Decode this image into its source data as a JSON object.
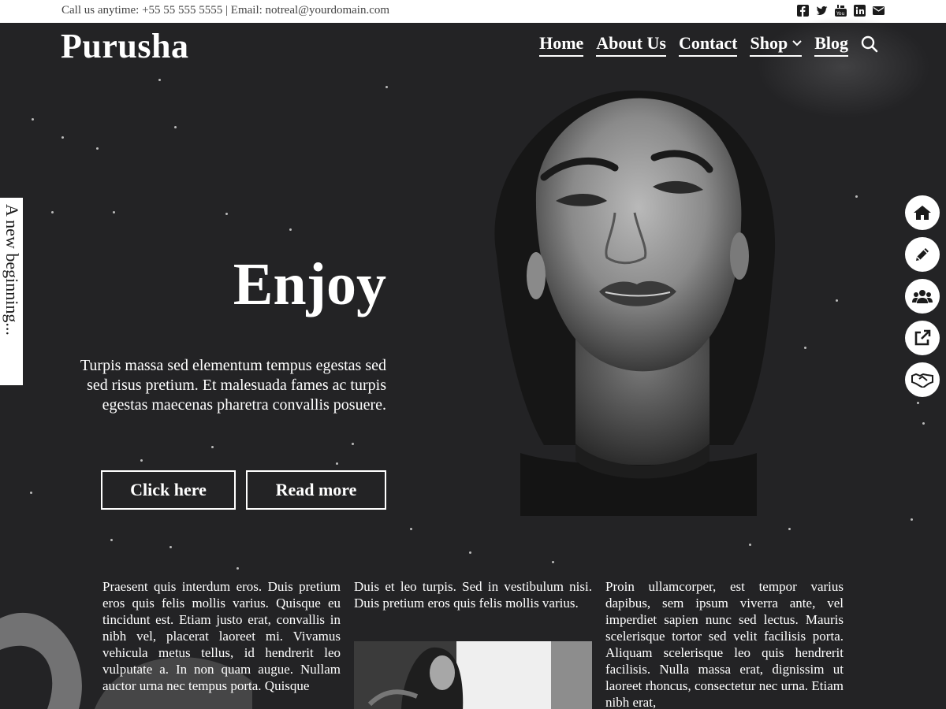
{
  "topbar": {
    "contact": "Call us anytime: +55 55 555 5555 | Email: notreal@yourdomain.com",
    "social_icons": [
      "facebook-icon",
      "twitter-icon",
      "youtube-icon",
      "linkedin-icon",
      "email-icon"
    ]
  },
  "header": {
    "logo": "Purusha",
    "nav": [
      {
        "label": "Home"
      },
      {
        "label": "About Us"
      },
      {
        "label": "Contact"
      },
      {
        "label": "Shop"
      },
      {
        "label": "Blog"
      }
    ]
  },
  "sidetab": {
    "label": "A new beginning..."
  },
  "hero": {
    "title": "Enjoy",
    "text": "Turpis massa sed elementum tempus egestas sed sed risus pretium. Et malesuada fames ac turpis egestas maecenas pharetra convallis posuere.",
    "buttons": [
      {
        "label": "Click here"
      },
      {
        "label": "Read more"
      }
    ]
  },
  "side_actions": [
    "home-icon",
    "pencil-icon",
    "users-icon",
    "external-link-icon",
    "handshake-icon"
  ],
  "columns": [
    "Praesent quis interdum eros. Duis pretium eros quis felis mollis varius. Quisque eu tincidunt est. Etiam justo erat, convallis in nibh vel, placerat laoreet mi. Vivamus vehicula metus tellus, id hendrerit leo vulputate a. In non quam augue. Nullam auctor urna nec tempus porta. Quisque",
    "Duis et leo turpis. Sed in vestibulum nisi. Duis pretium eros quis felis mollis varius.",
    "Proin ullamcorper, est tempor varius dapibus, sem ipsum viverra ante, vel imperdiet sapien nunc sed lectus. Mauris scelerisque tortor sed velit facilisis porta. Aliquam scelerisque leo quis hendrerit facilisis. Nulla massa erat, dignissim ut laoreet rhoncus, consectetur nec urna. Etiam nibh erat,"
  ],
  "colors": {
    "background": "#232325",
    "text": "#ffffff",
    "topbar": "#ffffff"
  }
}
